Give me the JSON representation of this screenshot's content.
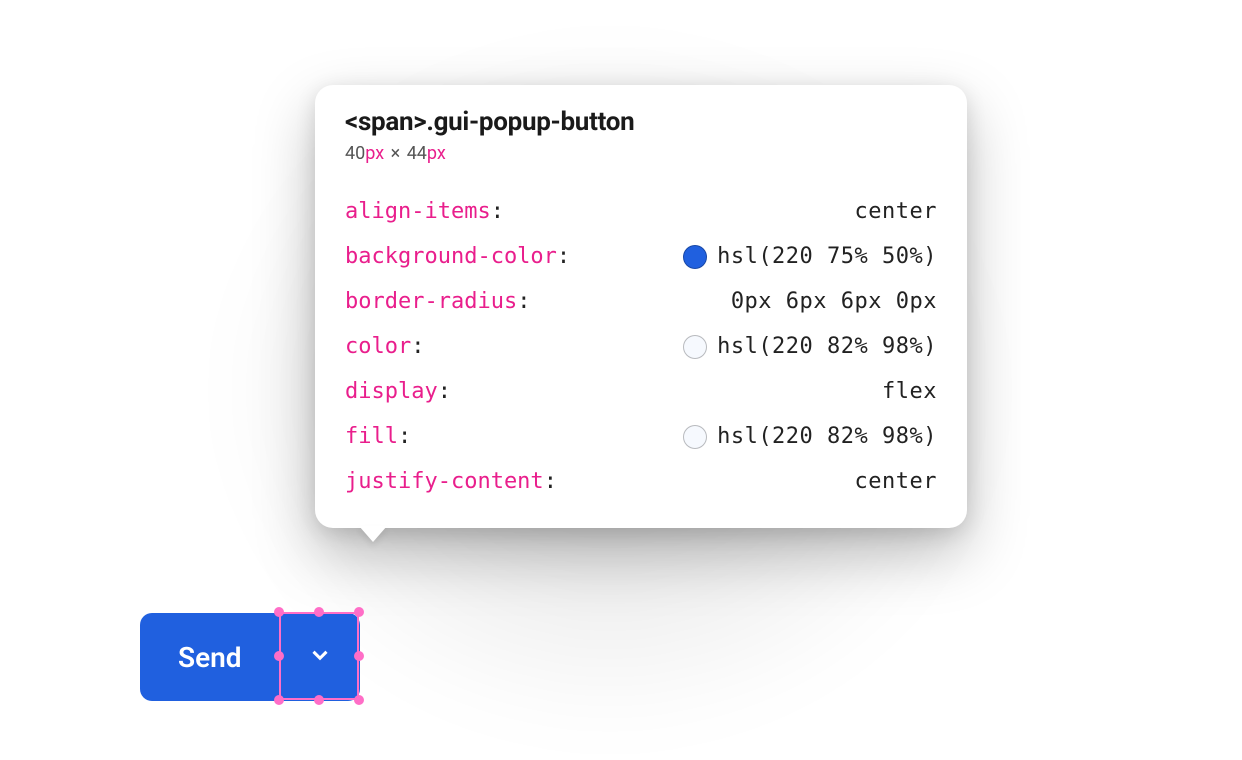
{
  "tooltip": {
    "selector": "<span>.gui-popup-button",
    "dims": {
      "w": "40",
      "h": "44",
      "unit": "px",
      "sep": "×"
    },
    "props": [
      {
        "name": "align-items",
        "value": "center",
        "swatch": null
      },
      {
        "name": "background-color",
        "value": "hsl(220 75% 50%)",
        "swatch": "hsl(220,75%,50%)"
      },
      {
        "name": "border-radius",
        "value": "0px 6px 6px 0px",
        "swatch": null
      },
      {
        "name": "color",
        "value": "hsl(220 82% 98%)",
        "swatch": "hsl(220,82%,98%)"
      },
      {
        "name": "display",
        "value": "flex",
        "swatch": null
      },
      {
        "name": "fill",
        "value": "hsl(220 82% 98%)",
        "swatch": "hsl(220,82%,98%)"
      },
      {
        "name": "justify-content",
        "value": "center",
        "swatch": null
      }
    ]
  },
  "button": {
    "main_label": "Send"
  },
  "colors": {
    "accent": "hsl(220 75% 50%)",
    "selection": "#ff6ec7"
  }
}
